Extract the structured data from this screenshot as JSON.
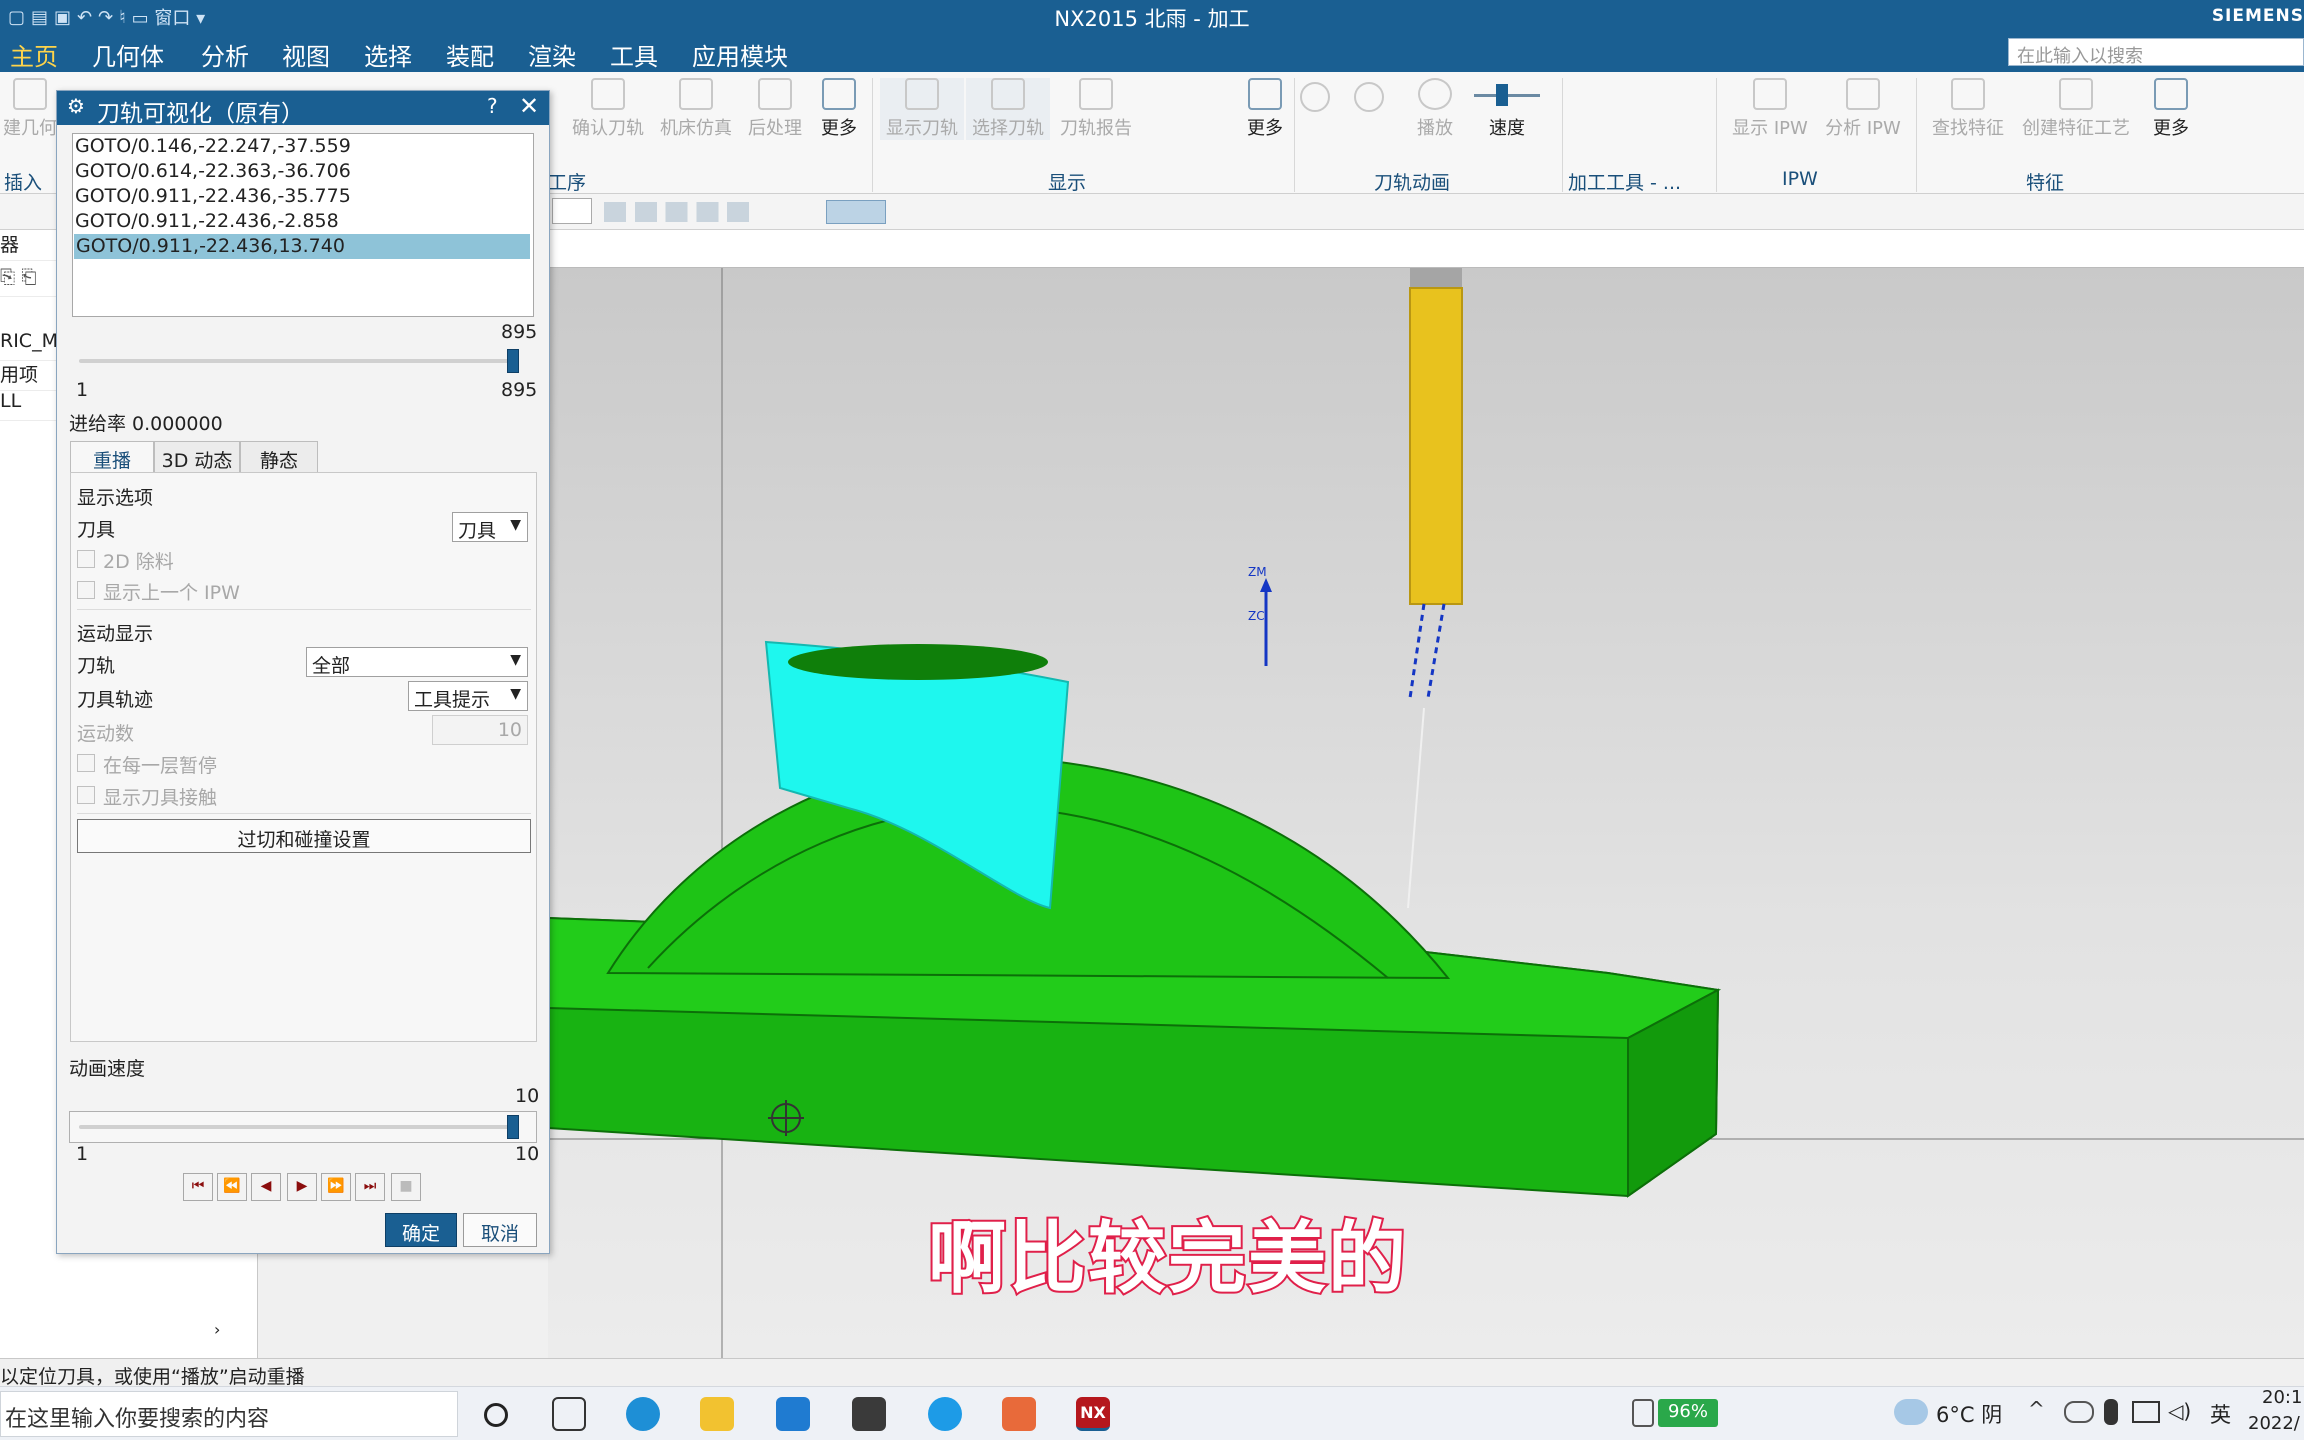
{
  "window": {
    "title": "NX2015 北雨 - 加工",
    "brand": "SIEMENS",
    "quick_access_window": "窗口"
  },
  "menu": {
    "items": [
      "主页",
      "几何体",
      "分析",
      "视图",
      "选择",
      "装配",
      "渲染",
      "工具",
      "应用模块"
    ],
    "search_placeholder": "在此输入以搜索"
  },
  "ribbon": {
    "left_fragment": "建几何",
    "insert_group": "插入",
    "buttons_ops": [
      "确认刀轨",
      "机床仿真",
      "后处理",
      "更多"
    ],
    "ops_group_fragment": "工序",
    "buttons_display": [
      "显示刀轨",
      "选择刀轨",
      "刀轨报告",
      "更多"
    ],
    "display_group": "显示",
    "buttons_anim": [
      "播放",
      "速度"
    ],
    "anim_group": "刀轨动画",
    "tools_group": "加工工具 - ...",
    "buttons_ipw": [
      "显示 IPW",
      "分析 IPW"
    ],
    "ipw_group": "IPW",
    "buttons_feature": [
      "查找特征",
      "创建特征工艺",
      "更多"
    ],
    "feature_group": "特征"
  },
  "leftnav": {
    "rows": [
      "器",
      "",
      "RIC_M",
      "用项",
      "LL"
    ]
  },
  "dialog": {
    "title": "刀轨可视化（原有）",
    "list": [
      "GOTO/0.146,-22.247,-37.559",
      "GOTO/0.614,-22.363,-36.706",
      "GOTO/0.911,-22.436,-35.775",
      "GOTO/0.911,-22.436,-2.858",
      "GOTO/0.911,-22.436,13.740"
    ],
    "selected_index": 4,
    "pos_slider": {
      "value": "895",
      "min": "1",
      "max": "895",
      "fraction": 1.0
    },
    "feed_rate": "进给率 0.000000",
    "tabs": [
      "重播",
      "3D 动态",
      "静态"
    ],
    "display_options": {
      "section": "显示选项",
      "tool_label": "刀具",
      "tool_value": "刀具",
      "remove_2d": "2D 除料",
      "show_prev_ipw": "显示上一个 IPW"
    },
    "motion_display": {
      "section": "运动显示",
      "path_label": "刀轨",
      "path_value": "全部",
      "trace_label": "刀具轨迹",
      "trace_value": "工具提示",
      "count_label": "运动数",
      "count_value": "10",
      "pause_layer": "在每一层暂停",
      "show_contact": "显示刀具接触"
    },
    "gouge_button": "过切和碰撞设置",
    "anim_speed": {
      "label": "动画速度",
      "value": "10",
      "min": "1",
      "max": "10",
      "fraction": 1.0
    },
    "ok": "确定",
    "cancel": "取消"
  },
  "viewport": {
    "subtitle": "啊比较完美的",
    "axis_z": "ZM",
    "axis_zc": "ZC"
  },
  "status": {
    "message": "以定位刀具，或使用“播放”启动重播"
  },
  "taskbar": {
    "search": "在这里输入你要搜索的内容",
    "battery": "96%",
    "weather": "6°C 阴",
    "ime": "英",
    "time": "20:1",
    "date": "2022/"
  }
}
